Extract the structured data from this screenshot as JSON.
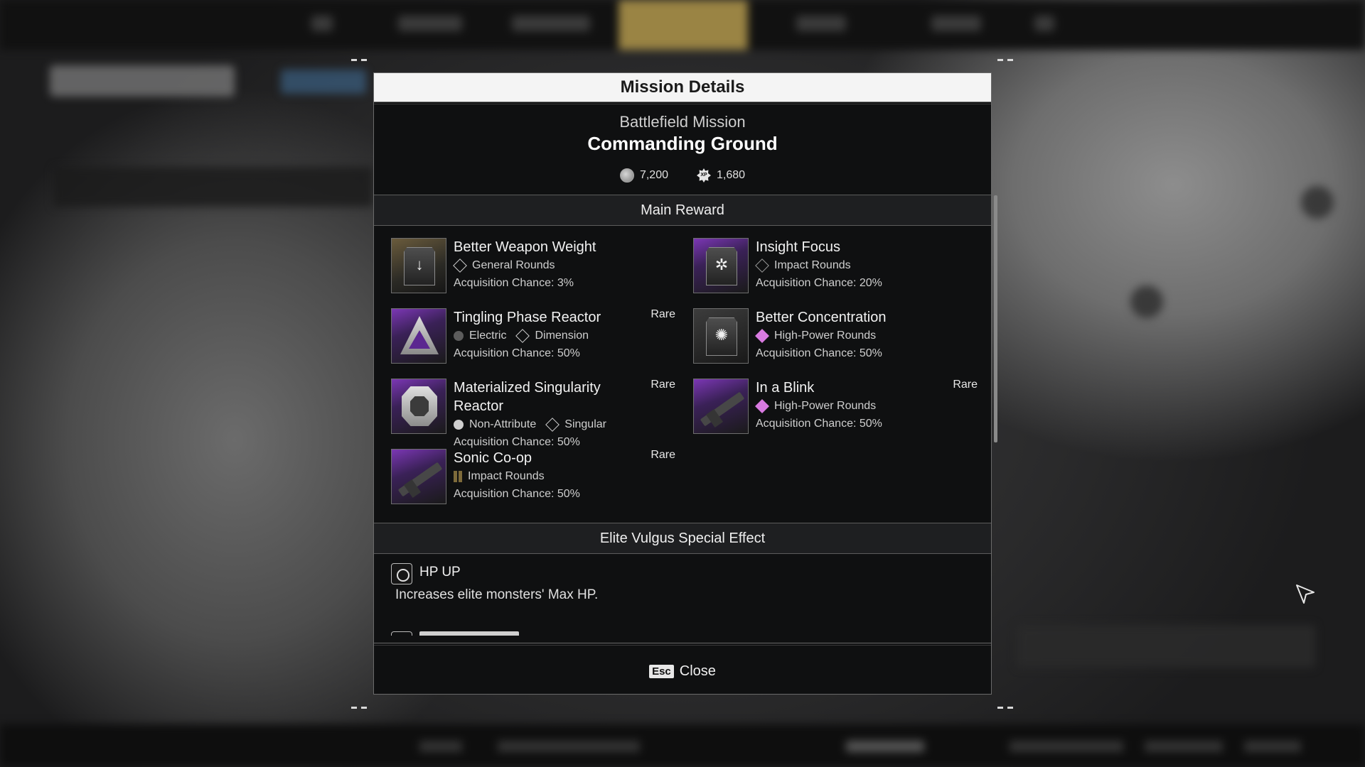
{
  "modal": {
    "title": "Mission Details",
    "mission_type": "Battlefield Mission",
    "mission_name": "Commanding Ground",
    "gold": "7,200",
    "xp": "1,680",
    "xp_icon_text": "XP"
  },
  "main_reward": {
    "title": "Main Reward",
    "items": [
      {
        "name": "Better Weapon Weight",
        "types": [
          "General Rounds"
        ],
        "chance": "Acquisition Chance: 3%",
        "rare": ""
      },
      {
        "name": "Insight Focus",
        "types": [
          "Impact Rounds"
        ],
        "chance": "Acquisition Chance: 20%",
        "rare": ""
      },
      {
        "name": "Tingling Phase Reactor",
        "types": [
          "Electric",
          "Dimension"
        ],
        "chance": "Acquisition Chance: 50%",
        "rare": "Rare"
      },
      {
        "name": "Better Concentration",
        "types": [
          "High-Power Rounds"
        ],
        "chance": "Acquisition Chance: 50%",
        "rare": ""
      },
      {
        "name": "Materialized Singularity Reactor",
        "types": [
          "Non-Attribute",
          "Singular"
        ],
        "chance": "Acquisition Chance: 50%",
        "rare": "Rare"
      },
      {
        "name": "In a Blink",
        "types": [
          "High-Power Rounds"
        ],
        "chance": "Acquisition Chance: 50%",
        "rare": "Rare"
      },
      {
        "name": "Sonic Co-op",
        "types": [
          "Impact Rounds"
        ],
        "chance": "Acquisition Chance: 50%",
        "rare": "Rare"
      }
    ]
  },
  "special_effect": {
    "title": "Elite Vulgus Special Effect",
    "effect_name": "HP UP",
    "effect_desc": "Increases elite monsters' Max HP."
  },
  "footer": {
    "key": "Esc",
    "close_label": "Close"
  },
  "icons": {
    "gold": "gold-coin-icon",
    "xp": "xp-badge-icon",
    "effect": "hp-up-icon",
    "cursor": "mouse-cursor-icon"
  },
  "colors": {
    "header_bg": "#f4f4f4",
    "rare_accent": "#7b37b4",
    "high_power": "#d87ae0"
  }
}
